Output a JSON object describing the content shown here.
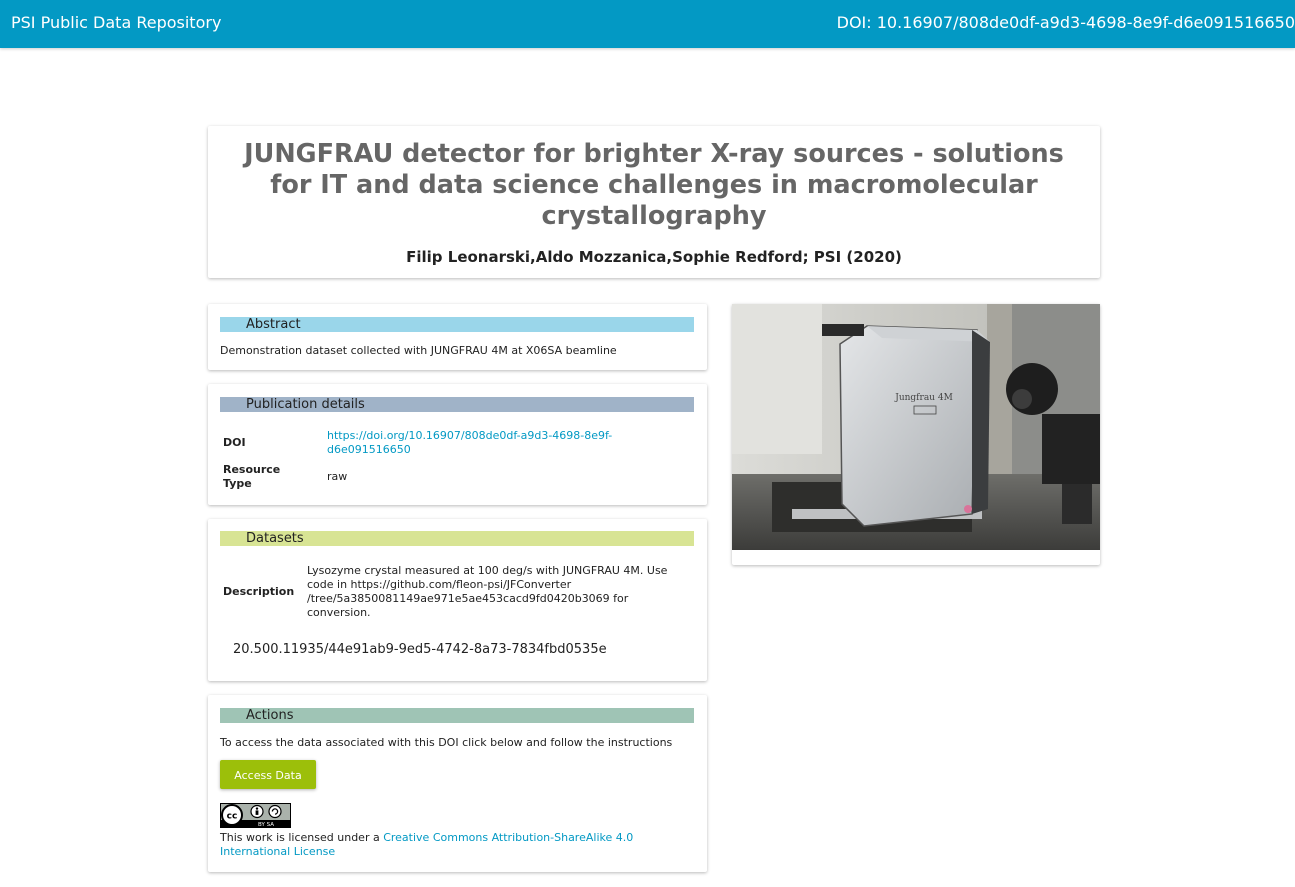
{
  "topbar": {
    "brand": "PSI Public Data Repository",
    "doi": "DOI: 10.16907/808de0df-a9d3-4698-8e9f-d6e091516650"
  },
  "title_card": {
    "title": "JUNGFRAU detector for brighter X-ray sources - solutions for IT and data science challenges in macromolecular crystallography",
    "authors": "Filip Leonarski,Aldo Mozzanica,Sophie Redford; PSI (2020)"
  },
  "abstract": {
    "heading": "Abstract",
    "text": "Demonstration dataset collected with JUNGFRAU 4M at X06SA beamline"
  },
  "publication": {
    "heading": "Publication details",
    "doi_label": "DOI",
    "doi_link_line1": "https://doi.org/10.16907/808de0df-a9d3-4698-8e9f-",
    "doi_link_line2": "d6e091516650",
    "resource_label_line1": "Resource",
    "resource_label_line2": "Type",
    "resource_value": "raw"
  },
  "datasets": {
    "heading": "Datasets",
    "description_label": "Description",
    "description_lines": [
      "Lysozyme crystal measured at 100 deg/s with JUNGFRAU 4M. Use",
      "code in https://github.com/fleon-psi/JFConverter",
      "/tree/5a3850081149ae971e5ae453cacd9fd0420b3069 for",
      "conversion."
    ],
    "handle": "20.500.11935/44e91ab9-9ed5-4742-8a73-7834fbd0535e"
  },
  "actions": {
    "heading": "Actions",
    "text": "To access the data associated with this DOI click below and follow the instructions",
    "button_label": "Access Data",
    "license_prefix": "This work is licensed under a ",
    "license_link_line1": "Creative Commons Attribution-ShareAlike 4.0",
    "license_link_line2": "International License",
    "cc_badge_text": "BY SA"
  },
  "image": {
    "detector_label": "Jungfrau 4M"
  },
  "colors": {
    "topbar": "#0399c4",
    "abstract_head": "#9ad6ea",
    "publication_head": "#a0b3c8",
    "datasets_head": "#d8e494",
    "actions_head": "#9fc4b5",
    "button": "#9cbf0a",
    "link": "#0399c4"
  }
}
